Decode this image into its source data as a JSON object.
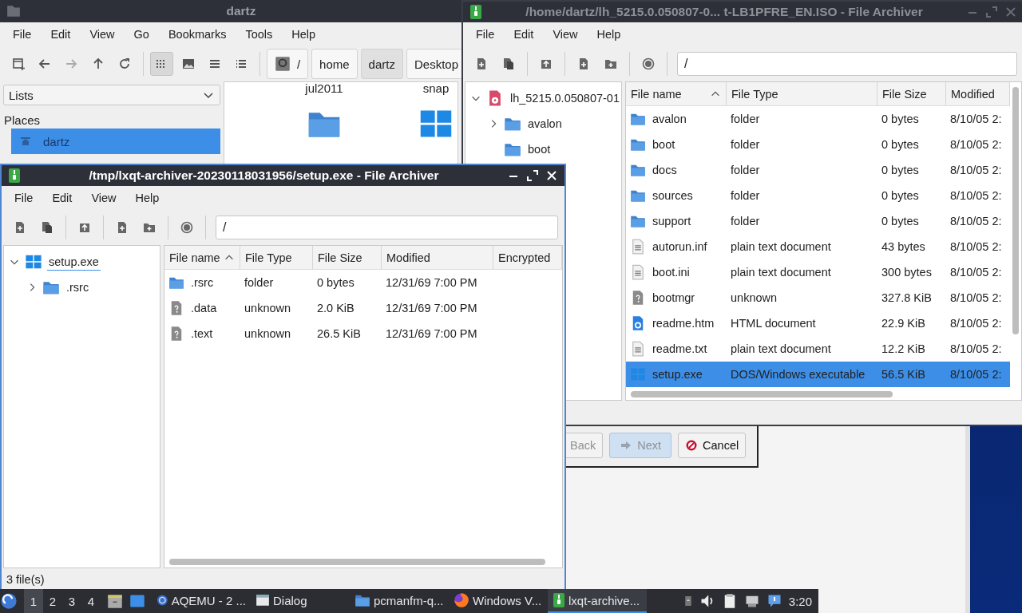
{
  "file_manager": {
    "title": "dartz",
    "menu": [
      "File",
      "Edit",
      "View",
      "Go",
      "Bookmarks",
      "Tools",
      "Help"
    ],
    "view_buttons": [
      {
        "kind": "icons",
        "selected": true
      },
      {
        "kind": "thumbnails",
        "selected": false
      },
      {
        "kind": "compact",
        "selected": false
      },
      {
        "kind": "details",
        "selected": false
      }
    ],
    "path": [
      {
        "label": "/",
        "kind": "root",
        "selected": false
      },
      {
        "label": "home",
        "kind": "dir",
        "selected": false
      },
      {
        "label": "dartz",
        "kind": "dir",
        "selected": true
      },
      {
        "label": "Desktop",
        "kind": "dir",
        "selected": false
      }
    ],
    "side_panel": {
      "dropdown": "Lists",
      "heading": "Places",
      "items": [
        {
          "label": "dartz",
          "selected": true
        }
      ]
    },
    "icon_labels": [
      "jul2011",
      "snap"
    ],
    "icons": [
      {
        "kind": "folder"
      },
      {
        "kind": "exe"
      }
    ]
  },
  "archivers": [
    {
      "title": "/home/dartz/lh_5215.0.050807-0...  t-LB1PFRE_EN.ISO - File Archiver",
      "active": false,
      "menu": [
        "File",
        "Edit",
        "View",
        "Help"
      ],
      "path": "/",
      "tree": [
        {
          "label": "lh_5215.0.050807-01",
          "kind": "disc",
          "expanded": true,
          "selected": false,
          "children": [
            {
              "label": "avalon",
              "kind": "folder",
              "expanded": false,
              "selected": false
            },
            {
              "label": "boot",
              "kind": "folder",
              "selected": false
            }
          ]
        }
      ],
      "columns": [
        {
          "label": "File name",
          "sorted": true
        },
        {
          "label": "File Type",
          "sorted": false
        },
        {
          "label": "File Size",
          "sorted": false
        },
        {
          "label": "Modified",
          "sorted": false
        }
      ],
      "rows": [
        {
          "name": "avalon",
          "type": "folder",
          "size": "0 bytes",
          "modified": "8/10/05 2:",
          "kind": "folder",
          "selected": false
        },
        {
          "name": "boot",
          "type": "folder",
          "size": "0 bytes",
          "modified": "8/10/05 2:",
          "kind": "folder",
          "selected": false
        },
        {
          "name": "docs",
          "type": "folder",
          "size": "0 bytes",
          "modified": "8/10/05 2:",
          "kind": "folder",
          "selected": false
        },
        {
          "name": "sources",
          "type": "folder",
          "size": "0 bytes",
          "modified": "8/10/05 2:",
          "kind": "folder",
          "selected": false
        },
        {
          "name": "support",
          "type": "folder",
          "size": "0 bytes",
          "modified": "8/10/05 2:",
          "kind": "folder",
          "selected": false
        },
        {
          "name": "autorun.inf",
          "type": "plain text document",
          "size": "43 bytes",
          "modified": "8/10/05 2:",
          "kind": "text",
          "selected": false
        },
        {
          "name": "boot.ini",
          "type": "plain text document",
          "size": "300 bytes",
          "modified": "8/10/05 2:",
          "kind": "text",
          "selected": false
        },
        {
          "name": "bootmgr",
          "type": "unknown",
          "size": "327.8 KiB",
          "modified": "8/10/05 2:",
          "kind": "unknown",
          "selected": false
        },
        {
          "name": "readme.htm",
          "type": "HTML document",
          "size": "22.9 KiB",
          "modified": "8/10/05 2:",
          "kind": "html",
          "selected": false
        },
        {
          "name": "readme.txt",
          "type": "plain text document",
          "size": "12.2 KiB",
          "modified": "8/10/05 2:",
          "kind": "text",
          "selected": false
        },
        {
          "name": "setup.exe",
          "type": "DOS/Windows executable",
          "size": "56.5 KiB",
          "modified": "8/10/05 2:",
          "kind": "exe",
          "selected": true
        }
      ]
    },
    {
      "title": "/tmp/lxqt-archiver-20230118031956/setup.exe - File Archiver",
      "active": true,
      "menu": [
        "File",
        "Edit",
        "View",
        "Help"
      ],
      "path": "/",
      "tree": [
        {
          "label": "setup.exe",
          "kind": "exe",
          "expanded": true,
          "selected": true,
          "children": [
            {
              "label": ".rsrc",
              "kind": "folder",
              "expanded": false,
              "selected": false
            }
          ]
        }
      ],
      "columns": [
        {
          "label": "File name",
          "sorted": true
        },
        {
          "label": "File Type",
          "sorted": false
        },
        {
          "label": "File Size",
          "sorted": false
        },
        {
          "label": "Modified",
          "sorted": false
        },
        {
          "label": "Encrypted",
          "sorted": false
        }
      ],
      "rows": [
        {
          "name": ".rsrc",
          "type": "folder",
          "size": "0 bytes",
          "modified": "12/31/69 7:00 PM",
          "kind": "folder",
          "selected": false
        },
        {
          "name": ".data",
          "type": "unknown",
          "size": "2.0 KiB",
          "modified": "12/31/69 7:00 PM",
          "kind": "unknown",
          "selected": false
        },
        {
          "name": ".text",
          "type": "unknown",
          "size": "26.5 KiB",
          "modified": "12/31/69 7:00 PM",
          "kind": "unknown",
          "selected": false
        }
      ],
      "status": "3 file(s)"
    }
  ],
  "wizard": {
    "buttons": [
      {
        "label": "Back",
        "kind": "back",
        "disabled": true
      },
      {
        "label": "Next",
        "kind": "next",
        "disabled": true
      },
      {
        "label": "Cancel",
        "kind": "cancel",
        "disabled": false
      }
    ]
  },
  "taskbar": {
    "desktops": [
      {
        "label": "1",
        "selected": true
      },
      {
        "label": "2",
        "selected": false
      },
      {
        "label": "3",
        "selected": false
      },
      {
        "label": "4",
        "selected": false
      }
    ],
    "tasks": [
      {
        "label": "AQEMU - 2 ...",
        "kind": "qemu",
        "selected": false
      },
      {
        "label": "Dialog",
        "kind": "dialog",
        "selected": false
      },
      {
        "label": "pcmanfm-q...",
        "kind": "folder",
        "selected": false
      },
      {
        "label": "Windows V...",
        "kind": "browser",
        "selected": false
      },
      {
        "label": "lxqt-archive...",
        "kind": "archiver",
        "selected": true
      }
    ],
    "clock": "3:20"
  }
}
